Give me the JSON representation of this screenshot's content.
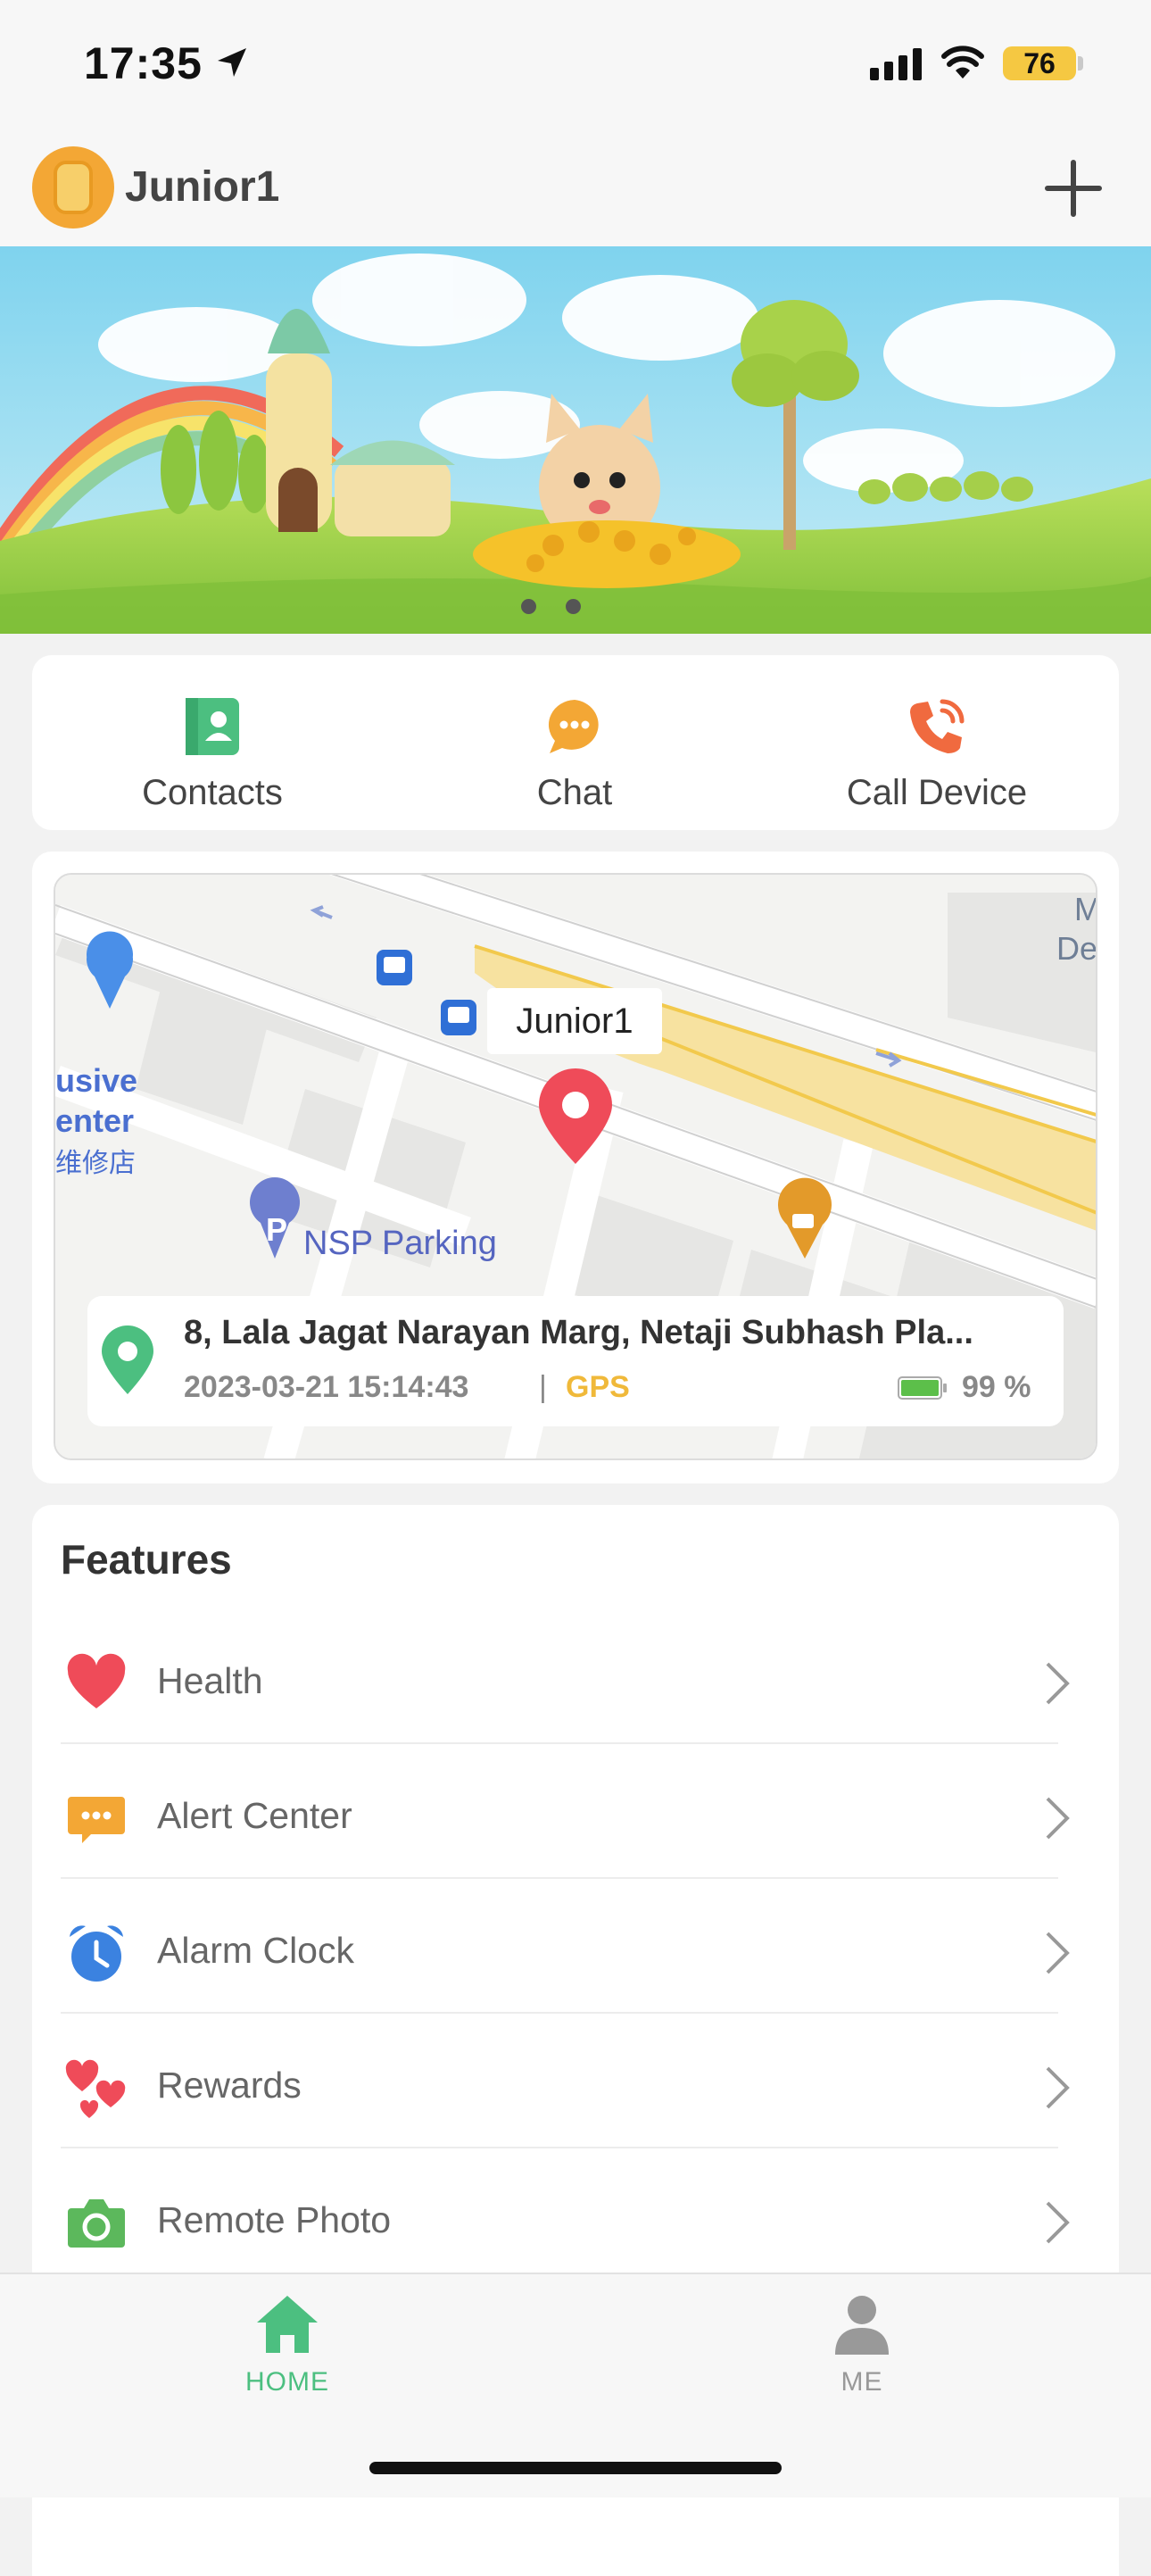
{
  "status_bar": {
    "time": "17:35",
    "battery": "76"
  },
  "header": {
    "device_name": "Junior1",
    "add_icon": "plus-icon"
  },
  "banner": {
    "dot_count": 2
  },
  "quick_actions": [
    {
      "label": "Contacts",
      "icon": "contacts-icon",
      "color": "#4cbf80"
    },
    {
      "label": "Chat",
      "icon": "chat-bubble-icon",
      "color": "#f3a735"
    },
    {
      "label": "Call Device",
      "icon": "phone-call-icon",
      "color": "#f06a3f"
    }
  ],
  "map": {
    "marker_label": "Junior1",
    "address": "8, Lala Jagat Narayan Marg, Netaji Subhash Pla...",
    "timestamp": "2023-03-21 15:14:43",
    "separator": "|",
    "source": "GPS",
    "battery_percent": "99 %",
    "labels": {
      "poi_left": "usive",
      "poi_left2": "enter",
      "poi_left3": "维修店",
      "parking": "NSP Parking",
      "top_right1": "M",
      "top_right2": "De"
    }
  },
  "features": {
    "title": "Features",
    "items": [
      {
        "label": "Health",
        "icon": "heart-icon"
      },
      {
        "label": "Alert Center",
        "icon": "alert-message-icon"
      },
      {
        "label": "Alarm Clock",
        "icon": "alarm-clock-icon"
      },
      {
        "label": "Rewards",
        "icon": "hearts-reward-icon"
      },
      {
        "label": "Remote Photo",
        "icon": "camera-icon"
      }
    ]
  },
  "tabs": [
    {
      "label": "HOME",
      "icon": "home-icon",
      "active": true
    },
    {
      "label": "ME",
      "icon": "person-icon",
      "active": false
    }
  ],
  "colors": {
    "accent": "#4cbf80",
    "inactive": "#999999",
    "marker": "#ef4b59"
  }
}
